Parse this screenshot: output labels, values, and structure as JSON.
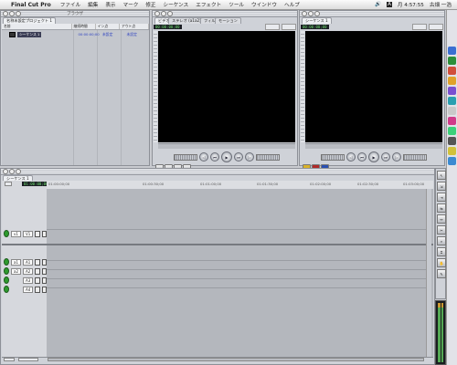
{
  "menubar": {
    "app_name": "Final Cut Pro",
    "items": [
      "ファイル",
      "編集",
      "表示",
      "マーク",
      "修正",
      "シーケンス",
      "エフェクト",
      "ツール",
      "ウインドウ",
      "ヘルプ"
    ],
    "time": "月 4:57:55",
    "user": "古畑 一浩"
  },
  "browser": {
    "title": "ブラウザ",
    "tab": "名称未設定プロジェクト 1",
    "columns": [
      "名前",
      "継続時間",
      "イン点",
      "アウト点"
    ],
    "row": {
      "name": "シーケンス 1",
      "duration": "00:00:00;00",
      "in": "未設定",
      "out": "未設定"
    }
  },
  "viewer": {
    "tabs": [
      "ビデオ",
      "ステレオ (a1a2)",
      "フィルタ",
      "モーション"
    ],
    "timecode": "00:00:00;00"
  },
  "canvas": {
    "tab": "シーケンス 1",
    "timecode": "00:00:00;00"
  },
  "timeline": {
    "tab": "シーケンス 1",
    "timecode": "01:00:00;00",
    "ruler": [
      "01:00:00;00",
      "01:00:30;00",
      "01:01:00;00",
      "01:01:30;00",
      "01:02:00;00",
      "01:02:30;00",
      "01:03:00;00"
    ],
    "tracks": [
      {
        "src": "v1",
        "dst": "V1"
      },
      {
        "src": "a1",
        "dst": "A1"
      },
      {
        "src": "a2",
        "dst": "A2"
      },
      {
        "src": "",
        "dst": "A3"
      },
      {
        "src": "",
        "dst": "A4"
      }
    ]
  },
  "dock_colors": [
    "#3b6fd1",
    "#2c8f3a",
    "#d14f3b",
    "#e0a22a",
    "#7a4fd1",
    "#2a9fb0",
    "#c9c9c9",
    "#d13b8a",
    "#3bd17a",
    "#555555",
    "#d1c13b",
    "#3b8ad1"
  ]
}
